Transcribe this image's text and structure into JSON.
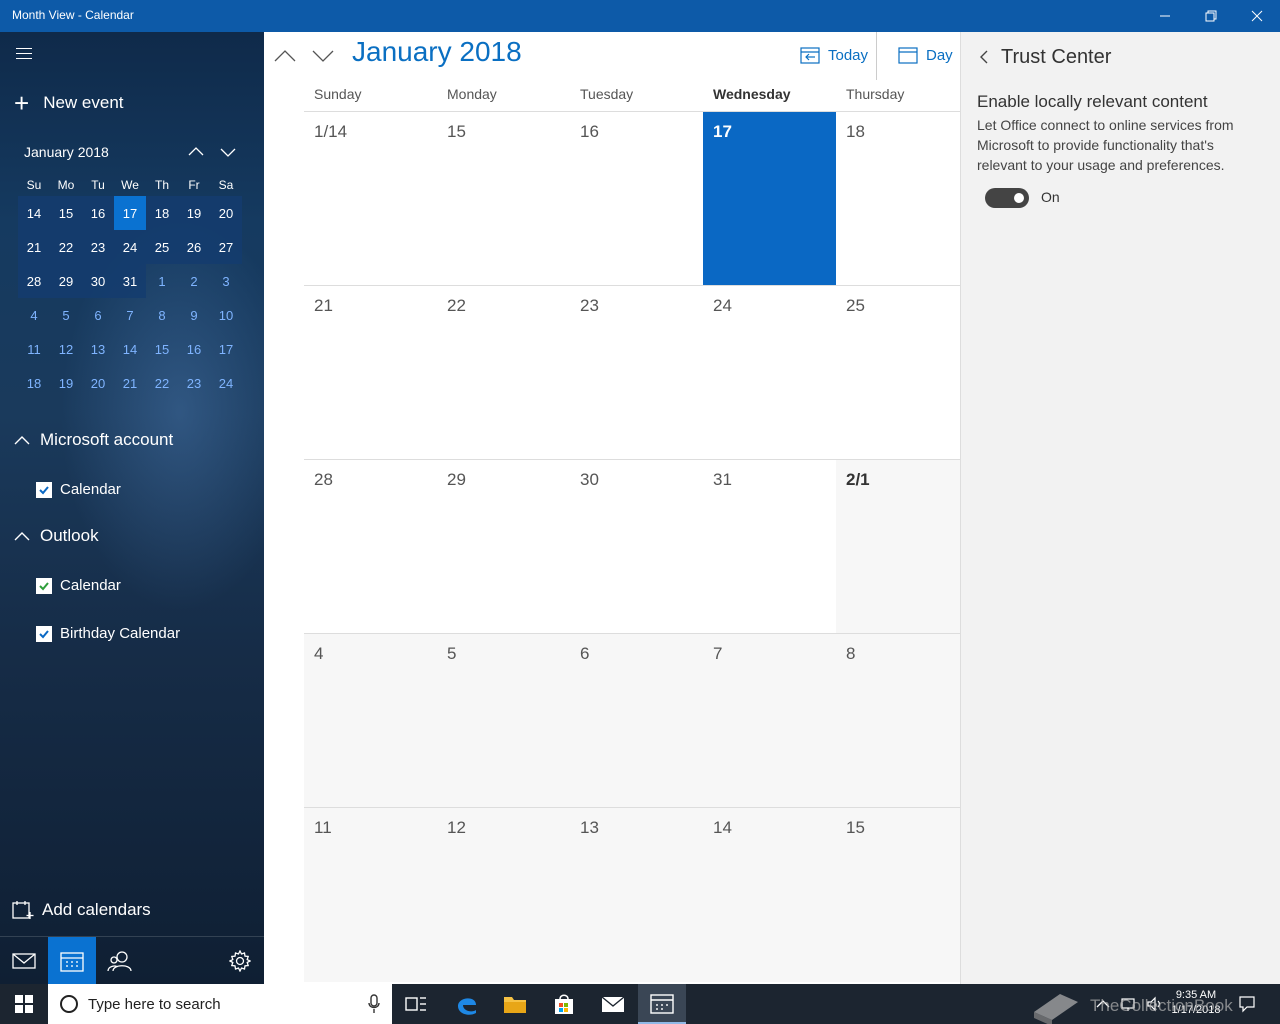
{
  "window": {
    "title": "Month View - Calendar"
  },
  "sidebar": {
    "new_event_label": "New event",
    "mini_calendar": {
      "month_label": "January 2018",
      "day_headers": [
        "Su",
        "Mo",
        "Tu",
        "We",
        "Th",
        "Fr",
        "Sa"
      ],
      "weeks": [
        [
          "14",
          "15",
          "16",
          "17",
          "18",
          "19",
          "20"
        ],
        [
          "21",
          "22",
          "23",
          "24",
          "25",
          "26",
          "27"
        ],
        [
          "28",
          "29",
          "30",
          "31",
          "1",
          "2",
          "3"
        ],
        [
          "4",
          "5",
          "6",
          "7",
          "8",
          "9",
          "10"
        ],
        [
          "11",
          "12",
          "13",
          "14",
          "15",
          "16",
          "17"
        ],
        [
          "18",
          "19",
          "20",
          "21",
          "22",
          "23",
          "24"
        ]
      ],
      "today": "17"
    },
    "accounts": [
      {
        "name": "Microsoft account",
        "calendars": [
          {
            "label": "Calendar",
            "checked": true,
            "color": "#0a68c4"
          }
        ]
      },
      {
        "name": "Outlook",
        "calendars": [
          {
            "label": "Calendar",
            "checked": true,
            "color": "#2e9e3a"
          },
          {
            "label": "Birthday Calendar",
            "checked": true,
            "color": "#0a68c4"
          }
        ]
      }
    ],
    "add_calendars_label": "Add calendars"
  },
  "main": {
    "month_title": "January 2018",
    "today_label": "Today",
    "view_label": "Day",
    "day_headers": [
      "Sunday",
      "Monday",
      "Tuesday",
      "Wednesday",
      "Thursday"
    ],
    "today_column": "Wednesday",
    "weeks": [
      [
        "1/14",
        "15",
        "16",
        "17",
        "18"
      ],
      [
        "21",
        "22",
        "23",
        "24",
        "25"
      ],
      [
        "28",
        "29",
        "30",
        "31",
        "2/1"
      ],
      [
        "4",
        "5",
        "6",
        "7",
        "8"
      ],
      [
        "11",
        "12",
        "13",
        "14",
        "15"
      ]
    ],
    "today_date": "17"
  },
  "trust_center": {
    "title": "Trust Center",
    "heading": "Enable locally relevant content",
    "description": "Let Office connect to online services from Microsoft to provide functionality that's relevant to your usage and preferences.",
    "toggle_state_label": "On",
    "toggle_on": true
  },
  "taskbar": {
    "search_placeholder": "Type here to search",
    "time": "9:35 AM",
    "date": "1/17/2018"
  },
  "watermark": {
    "text": "TheCollectionBook"
  },
  "colors": {
    "accent": "#0a68c4",
    "title_bar": "#0d5aa8",
    "taskbar": "#1c2530"
  }
}
